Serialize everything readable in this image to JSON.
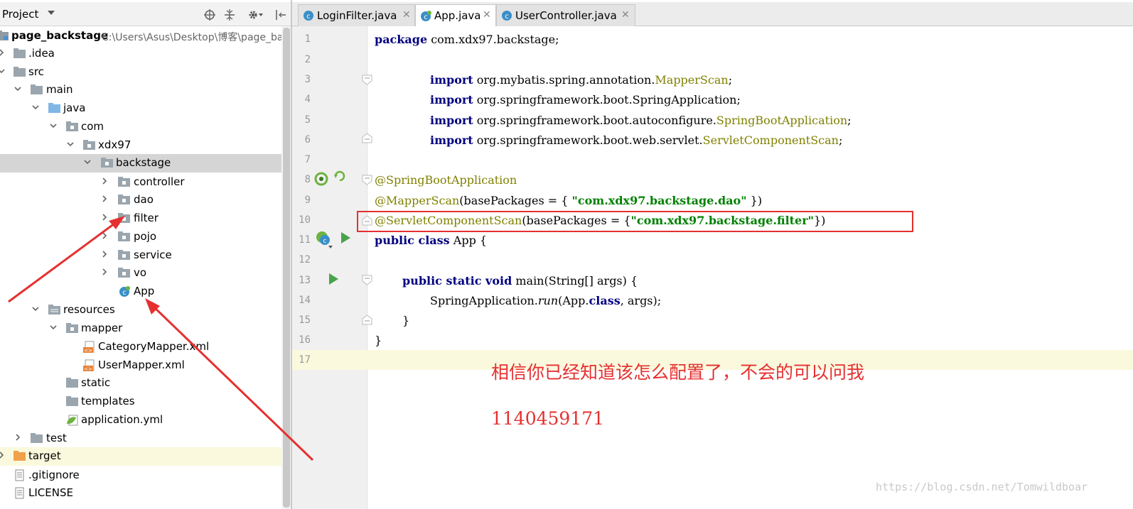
{
  "project_panel": {
    "title": "Project",
    "tree": [
      {
        "id": "root",
        "label": "page_backstage",
        "path": "C:\\Users\\Asus\\Desktop\\博客\\page_ba",
        "bold": true
      },
      {
        "id": "idea",
        "label": ".idea"
      },
      {
        "id": "src",
        "label": "src"
      },
      {
        "id": "main",
        "label": "main"
      },
      {
        "id": "java",
        "label": "java"
      },
      {
        "id": "com",
        "label": "com"
      },
      {
        "id": "xdx97",
        "label": "xdx97"
      },
      {
        "id": "backstage",
        "label": "backstage"
      },
      {
        "id": "controller",
        "label": "controller"
      },
      {
        "id": "dao",
        "label": "dao"
      },
      {
        "id": "filter",
        "label": "filter"
      },
      {
        "id": "pojo",
        "label": "pojo"
      },
      {
        "id": "service",
        "label": "service"
      },
      {
        "id": "vo",
        "label": "vo"
      },
      {
        "id": "app",
        "label": "App"
      },
      {
        "id": "resources",
        "label": "resources"
      },
      {
        "id": "mapper",
        "label": "mapper"
      },
      {
        "id": "category-mapper",
        "label": "CategoryMapper.xml"
      },
      {
        "id": "user-mapper",
        "label": "UserMapper.xml"
      },
      {
        "id": "static",
        "label": "static"
      },
      {
        "id": "templates",
        "label": "templates"
      },
      {
        "id": "application-yml",
        "label": "application.yml"
      },
      {
        "id": "test",
        "label": "test"
      },
      {
        "id": "target",
        "label": "target"
      },
      {
        "id": "gitignore",
        "label": ".gitignore"
      },
      {
        "id": "license",
        "label": "LICENSE"
      }
    ]
  },
  "tabs": [
    {
      "label": "LoginFilter.java",
      "active": false
    },
    {
      "label": "App.java",
      "active": true
    },
    {
      "label": "UserController.java",
      "active": false
    }
  ],
  "editor": {
    "line_numbers": [
      "1",
      "2",
      "3",
      "4",
      "5",
      "6",
      "7",
      "8",
      "9",
      "10",
      "11",
      "12",
      "13",
      "14",
      "15",
      "16",
      "17"
    ],
    "line1": {
      "kw": "package",
      "rest": " com.xdx97.backstage;"
    },
    "line3": {
      "kw": "import",
      "pkg": " org.mybatis.spring.annotation.",
      "cls": "MapperScan",
      "end": ";"
    },
    "line4": {
      "kw": "import",
      "pkg": " org.springframework.boot.SpringApplication;"
    },
    "line5": {
      "kw": "import",
      "pkg": " org.springframework.boot.autoconfigure.",
      "cls": "SpringBootApplication",
      "end": ";"
    },
    "line6": {
      "kw": "import",
      "pkg": " org.springframework.boot.web.servlet.",
      "cls": "ServletComponentScan",
      "end": ";"
    },
    "line8": {
      "ann": "@SpringBootApplication"
    },
    "line9": {
      "ann": "@MapperScan",
      "mid": "(basePackages = { ",
      "str": "\"com.xdx97.backstage.dao\"",
      "end": " })"
    },
    "line10": {
      "ann": "@ServletComponentScan",
      "mid": "(basePackages = {",
      "str": "\"com.xdx97.backstage.filter\"",
      "end": "})"
    },
    "line11": {
      "kw": "public class",
      "rest": " App {"
    },
    "line13": {
      "kw": "public static void",
      "rest": " main(String[] args) {"
    },
    "line14": {
      "pre": "SpringApplication.",
      "it": "run",
      "mid": "(App.",
      "kw": "class",
      "end": ", args);"
    },
    "line15": {
      "text": "}"
    },
    "line16": {
      "text": "}"
    }
  },
  "annotation": {
    "note": "相信你已经知道该怎么配置了，不会的可以问我",
    "contact": "1140459171",
    "watermark": "https://blog.csdn.net/Tomwildboar",
    "color": "#e53030"
  }
}
